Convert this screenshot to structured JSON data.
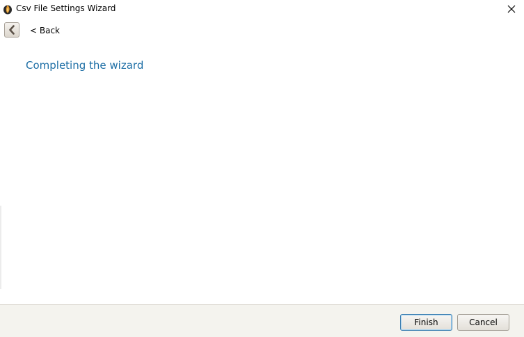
{
  "window": {
    "title": "Csv File Settings Wizard",
    "icon": "flame-app-icon",
    "close_icon": "close-icon"
  },
  "nav": {
    "back_icon": "chevron-left-icon",
    "back_label": "< Back"
  },
  "page": {
    "title": "Completing the wizard"
  },
  "footer": {
    "finish_label": "Finish",
    "cancel_label": "Cancel"
  },
  "colors": {
    "title_accent": "#1e6fa6",
    "footer_bg": "#f4f3ee",
    "default_button_border": "#3c7fb1"
  }
}
